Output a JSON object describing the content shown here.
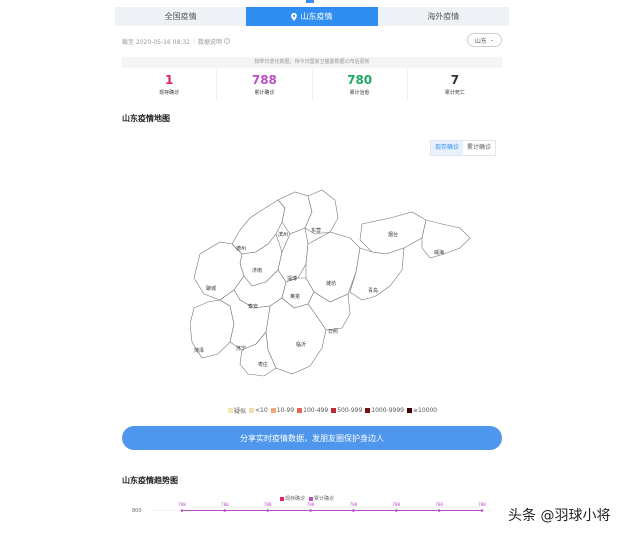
{
  "tabs": [
    {
      "label": "全国疫情",
      "active": false
    },
    {
      "label": "山东疫情",
      "active": true
    },
    {
      "label": "海外疫情",
      "active": false
    }
  ],
  "meta": {
    "timestamp": "截至 2020-05-16 08:32",
    "data_note": "数据说明"
  },
  "province_select": {
    "value": "山东"
  },
  "notice": "较昨日变化数据，待今日国家卫健委数据公布后更新",
  "stats": [
    {
      "value": "1",
      "label": "现存确诊",
      "color": "#e0245e"
    },
    {
      "value": "788",
      "label": "累计确诊",
      "color": "#b94fc4"
    },
    {
      "value": "780",
      "label": "累计治愈",
      "color": "#1aab5f"
    },
    {
      "value": "7",
      "label": "累计死亡",
      "color": "#333333"
    }
  ],
  "map_section": {
    "title": "山东疫情地图",
    "toggle": [
      "现存确诊",
      "累计确诊"
    ]
  },
  "cities": [
    "德州",
    "滨州",
    "东营",
    "烟台",
    "威海",
    "济南",
    "淄博",
    "潍坊",
    "青岛",
    "聊城",
    "泰安",
    "莱芜",
    "日照",
    "临沂",
    "菏泽",
    "济宁",
    "枣庄"
  ],
  "legend": [
    {
      "label": "疑似",
      "color": "#f3e9b0"
    },
    {
      "label": "<10",
      "color": "#f5dcb0"
    },
    {
      "label": "10-99",
      "color": "#f1a87a"
    },
    {
      "label": "100-499",
      "color": "#e6635a"
    },
    {
      "label": "500-999",
      "color": "#c1292e"
    },
    {
      "label": "1000-9999",
      "color": "#7a0f14"
    },
    {
      "label": "≥10000",
      "color": "#3b0508"
    }
  ],
  "share_button": "分享实时疫情数据，发朋友圈保护身边人",
  "trend_section": {
    "title": "山东疫情趋势图",
    "legend": [
      {
        "label": "现存确诊",
        "color": "#e0245e"
      },
      {
        "label": "累计确诊",
        "color": "#b94fc4"
      }
    ],
    "y_tick": "800"
  },
  "chart_data": {
    "type": "line",
    "title": "山东疫情趋势图",
    "series": [
      {
        "name": "累计确诊",
        "values": [
          788,
          788,
          788,
          788,
          788,
          788,
          788,
          788
        ]
      }
    ],
    "point_labels": [
      "788",
      "788",
      "788",
      "788",
      "788",
      "788",
      "788",
      "788"
    ],
    "y_ticks": [
      "800"
    ]
  },
  "watermark": "头条 @羽球小将"
}
